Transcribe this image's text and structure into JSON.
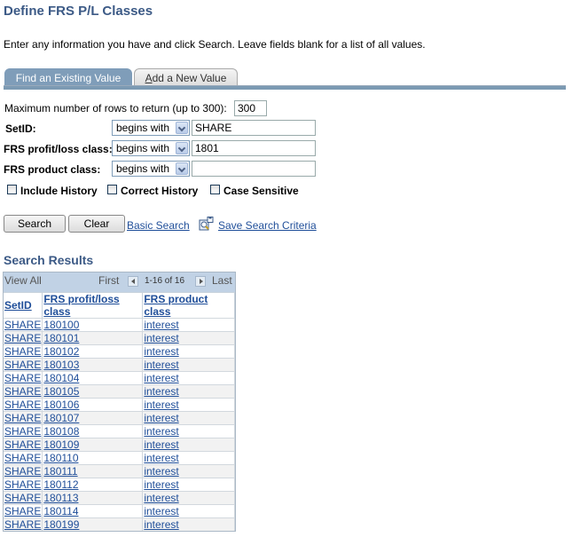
{
  "page": {
    "title": "Define FRS P/L Classes",
    "instructions": "Enter any information you have and click Search. Leave fields blank for a list of all values."
  },
  "tabs": [
    {
      "label": "Find an Existing Value",
      "active": true
    },
    {
      "label": "Add a New Value",
      "accesskey": "A",
      "label_rest": "dd a New Value",
      "active": false
    }
  ],
  "form": {
    "max_rows_label": "Maximum number of rows to return (up to 300):",
    "max_rows_value": "300",
    "fields": [
      {
        "label": "SetID:",
        "operator": "begins with",
        "value": "SHARE"
      },
      {
        "label": "FRS profit/loss class:",
        "operator": "begins with",
        "value": "1801"
      },
      {
        "label": "FRS product class:",
        "operator": "begins with",
        "value": ""
      }
    ],
    "checkboxes": [
      {
        "label": "Include History",
        "checked": false
      },
      {
        "label": "Correct History",
        "checked": false
      },
      {
        "label": "Case Sensitive",
        "checked": false
      }
    ]
  },
  "actions": {
    "search": "Search",
    "clear": "Clear",
    "basic_search": "Basic Search",
    "save_search": "Save Search Criteria"
  },
  "results": {
    "title": "Search Results",
    "view_all": "View All",
    "first": "First",
    "range": "1-16 of 16",
    "last": "Last",
    "columns": [
      "SetID",
      "FRS profit/loss class",
      "FRS product class"
    ],
    "rows": [
      [
        "SHARE",
        "180100",
        "interest"
      ],
      [
        "SHARE",
        "180101",
        "interest"
      ],
      [
        "SHARE",
        "180102",
        "interest"
      ],
      [
        "SHARE",
        "180103",
        "interest"
      ],
      [
        "SHARE",
        "180104",
        "interest"
      ],
      [
        "SHARE",
        "180105",
        "interest"
      ],
      [
        "SHARE",
        "180106",
        "interest"
      ],
      [
        "SHARE",
        "180107",
        "interest"
      ],
      [
        "SHARE",
        "180108",
        "interest"
      ],
      [
        "SHARE",
        "180109",
        "interest"
      ],
      [
        "SHARE",
        "180110",
        "interest"
      ],
      [
        "SHARE",
        "180111",
        "interest"
      ],
      [
        "SHARE",
        "180112",
        "interest"
      ],
      [
        "SHARE",
        "180113",
        "interest"
      ],
      [
        "SHARE",
        "180114",
        "interest"
      ],
      [
        "SHARE",
        "180199",
        "interest"
      ]
    ]
  }
}
